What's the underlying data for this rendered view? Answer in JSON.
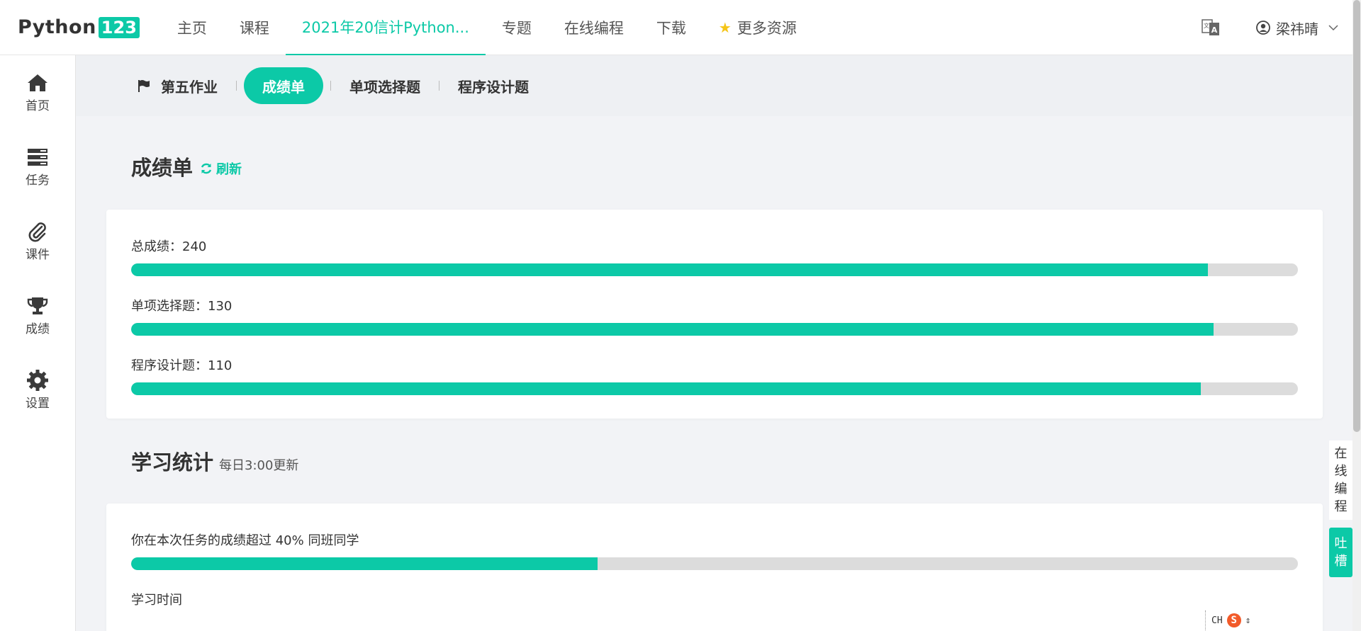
{
  "logo": {
    "text": "Python",
    "number": "123"
  },
  "nav": {
    "items": [
      {
        "label": "主页"
      },
      {
        "label": "课程"
      },
      {
        "label": "2021年20信计Python..."
      },
      {
        "label": "专题"
      },
      {
        "label": "在线编程"
      },
      {
        "label": "下载"
      },
      {
        "label": "更多资源"
      }
    ],
    "active_index": 2
  },
  "user": {
    "name": "梁祎晴"
  },
  "sidebar": {
    "items": [
      {
        "label": "首页",
        "icon": "home-icon"
      },
      {
        "label": "任务",
        "icon": "tasks-icon"
      },
      {
        "label": "课件",
        "icon": "paperclip-icon"
      },
      {
        "label": "成绩",
        "icon": "trophy-icon"
      },
      {
        "label": "设置",
        "icon": "gear-icon"
      }
    ]
  },
  "subtabs": {
    "items": [
      {
        "label": "第五作业"
      },
      {
        "label": "成绩单"
      },
      {
        "label": "单项选择题"
      },
      {
        "label": "程序设计题"
      }
    ],
    "active_index": 1
  },
  "grades": {
    "title": "成绩单",
    "refresh_label": "刷新",
    "rows": [
      {
        "label": "总成绩：240",
        "fill": 0.923
      },
      {
        "label": "单项选择题：130",
        "fill": 0.928
      },
      {
        "label": "程序设计题：110",
        "fill": 0.917
      }
    ]
  },
  "stats": {
    "title": "学习统计",
    "note": "每日3:00更新",
    "rank_label": "你在本次任务的成绩超过 40% 同班同学",
    "rank_fill": 0.4,
    "time_label": "学习时间"
  },
  "float": {
    "online_chars": [
      "在",
      "线",
      "编",
      "程"
    ],
    "feedback_chars": [
      "吐",
      "槽"
    ]
  },
  "ime": {
    "mode": "CH",
    "logo": "S"
  },
  "colors": {
    "accent": "#0cc9a7",
    "track": "#dcdcdc"
  }
}
